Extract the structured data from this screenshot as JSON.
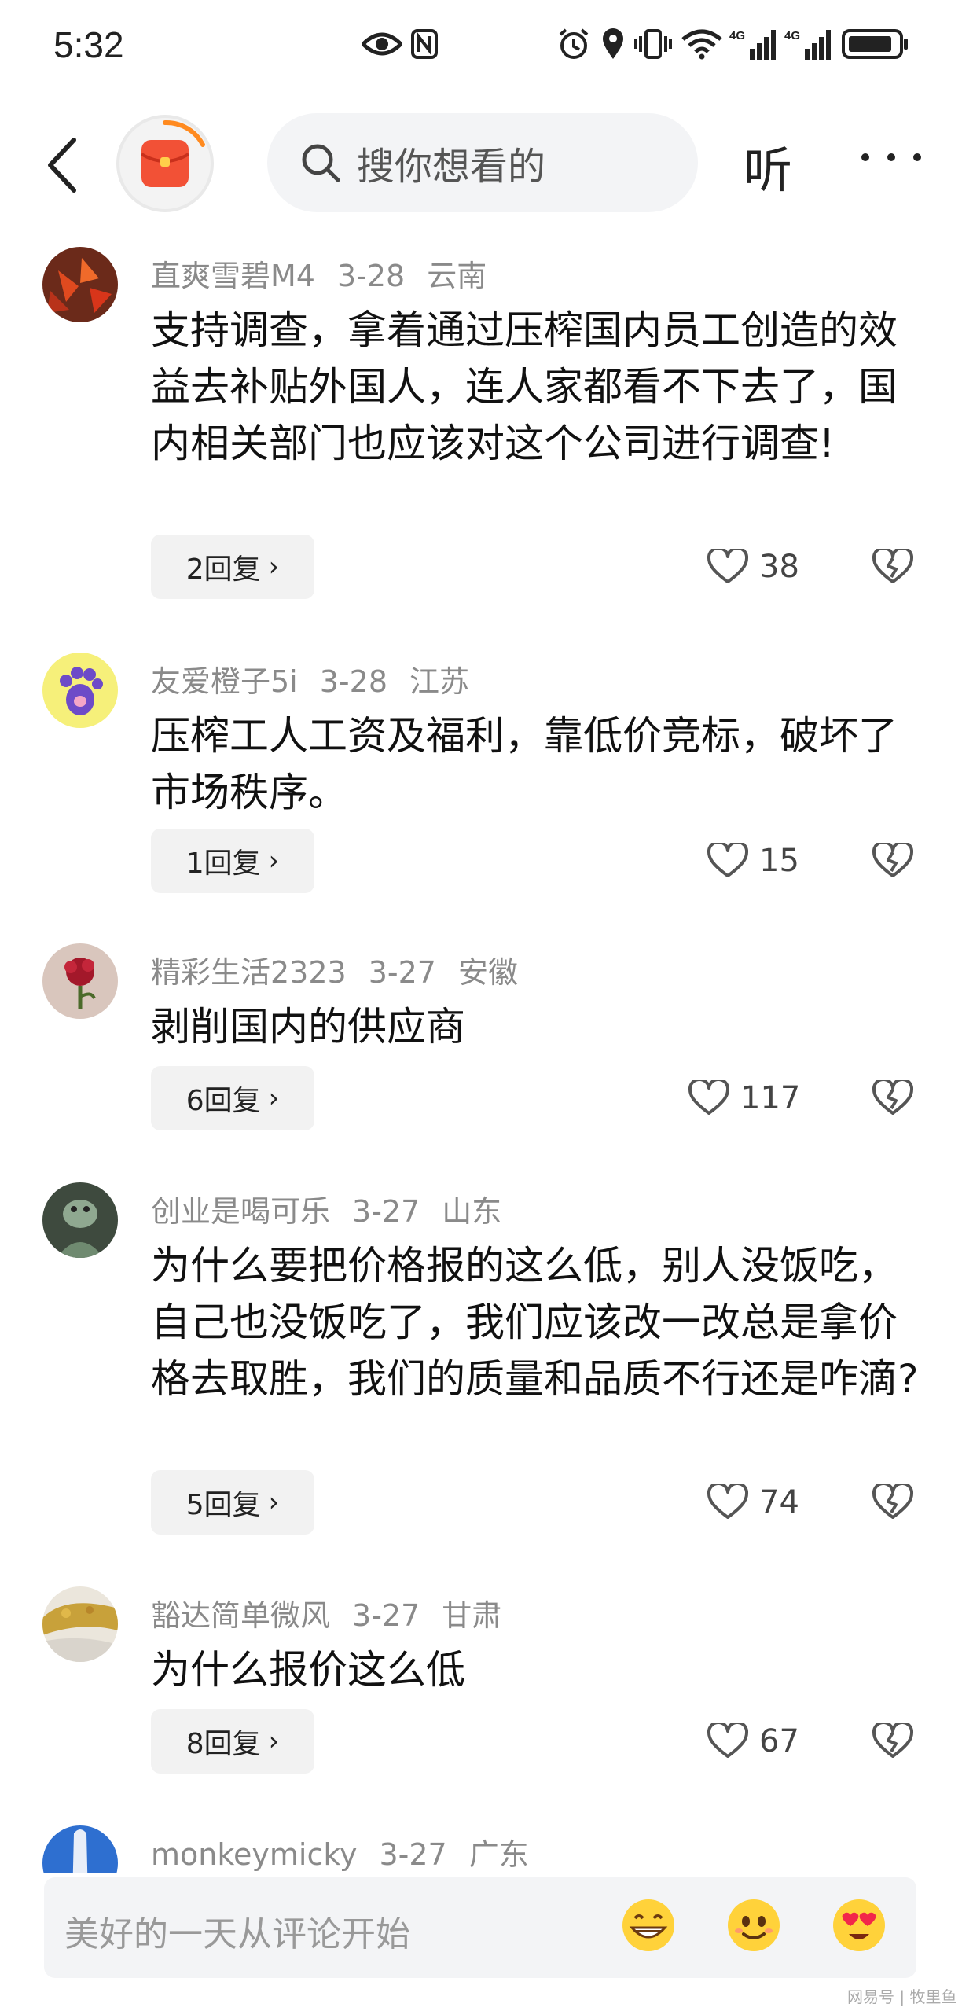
{
  "status_bar": {
    "time": "5:32",
    "signal_labels": [
      "4G",
      "4G"
    ]
  },
  "nav": {
    "search_placeholder": "搜你想看的",
    "listen_label": "听"
  },
  "comments": [
    {
      "user": "直爽雪碧M4",
      "date": "3-28",
      "location": "云南",
      "text": "支持调查，拿着通过压榨国内员工创造的效益去补贴外国人，连人家都看不下去了，国内相关部门也应该对这个公司进行调查!",
      "replies": "2回复",
      "likes": "38"
    },
    {
      "user": "友爱橙子5i",
      "date": "3-28",
      "location": "江苏",
      "text": "压榨工人工资及福利，靠低价竞标，破坏了市场秩序。",
      "replies": "1回复",
      "likes": "15"
    },
    {
      "user": "精彩生活2323",
      "date": "3-27",
      "location": "安徽",
      "text": "剥削国内的供应商",
      "replies": "6回复",
      "likes": "117"
    },
    {
      "user": "创业是喝可乐",
      "date": "3-27",
      "location": "山东",
      "text": "为什么要把价格报的这么低，别人没饭吃，自己也没饭吃了，我们应该改一改总是拿价格去取胜，我们的质量和品质不行还是咋滴?",
      "replies": "5回复",
      "likes": "74"
    },
    {
      "user": "豁达简单微风",
      "date": "3-27",
      "location": "甘肃",
      "text": "为什么报价这么低",
      "replies": "8回复",
      "likes": "67"
    },
    {
      "user": "monkeymicky",
      "date": "3-27",
      "location": "广东"
    }
  ],
  "input": {
    "placeholder": "美好的一天从评论开始"
  },
  "emojis": [
    "grinning-emoji",
    "smiling-emoji",
    "heart-eyes-emoji"
  ],
  "watermark": "网易号 | 牧里鱼"
}
